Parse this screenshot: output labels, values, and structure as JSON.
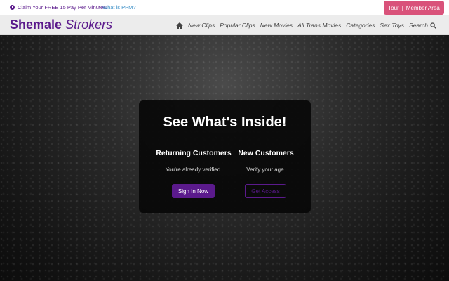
{
  "topbar": {
    "promo_text": "Claim Your FREE 15 Pay Per Minutes!",
    "promo_icon": "clock-icon",
    "ppm_link": "What is PPM?",
    "tour_label": "Tour",
    "separator": "|",
    "member_label": "Member Area"
  },
  "header": {
    "logo_part1": "Shemale",
    "logo_part2": "Strokers",
    "nav": {
      "home_icon": "home-icon",
      "new_clips": "New Clips",
      "popular_clips": "Popular Clips",
      "new_movies": "New Movies",
      "all_trans_movies": "All Trans Movies",
      "categories": "Categories",
      "sex_toys": "Sex Toys",
      "search": "Search",
      "search_icon": "search-icon"
    }
  },
  "colors": {
    "brand_purple": "#5b1a8c",
    "tour_pink": "#d9527a",
    "link_blue": "#3a8fc7"
  },
  "card": {
    "title": "See What's Inside!",
    "returning": {
      "heading": "Returning Customers",
      "text": "You're already verified.",
      "button": "Sign In Now"
    },
    "new": {
      "heading": "New Customers",
      "text": "Verify your age.",
      "button": "Get Access"
    }
  }
}
